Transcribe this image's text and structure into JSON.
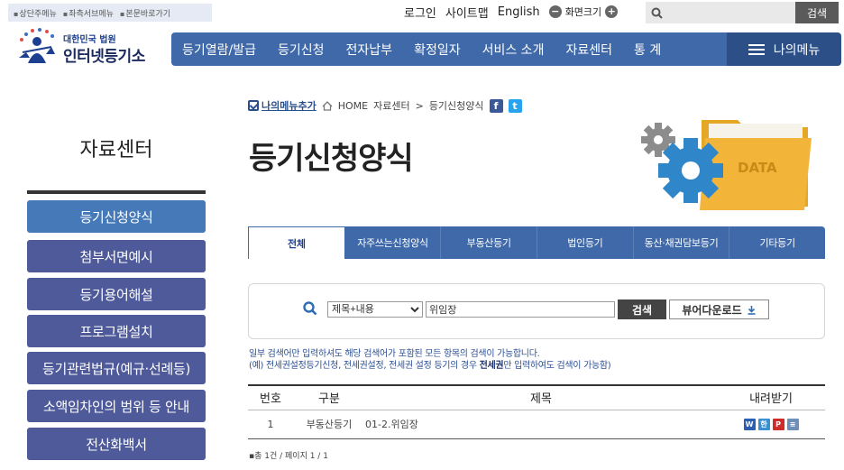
{
  "skip_links": [
    "상단주메뉴",
    "좌측서브메뉴",
    "본문바로가기"
  ],
  "util": {
    "login": "로그인",
    "sitemap": "사이트맵",
    "english": "English",
    "zoom_label": "화면크기",
    "zoom_out": "−",
    "zoom_in": "+"
  },
  "top_search": {
    "placeholder": "",
    "button": "검색"
  },
  "logo": {
    "line1": "대한민국 법원",
    "line2": "인터넷등기소"
  },
  "gnb": {
    "items": [
      "등기열람/발급",
      "등기신청",
      "전자납부",
      "확정일자",
      "서비스 소개",
      "자료센터",
      "통 계"
    ],
    "my_menu": "나의메뉴"
  },
  "sidebar": {
    "title": "자료센터",
    "items": [
      {
        "label": "등기신청양식"
      },
      {
        "label": "첨부서면예시"
      },
      {
        "label": "등기용어해설"
      },
      {
        "label": "프로그램설치"
      },
      {
        "label": "등기관련법규(예규·선례등)"
      },
      {
        "label": "소액임차인의 범위 등 안내"
      },
      {
        "label": "전산화백서"
      }
    ]
  },
  "breadcrumb": {
    "add_menu": "나의메뉴추가",
    "home": "HOME",
    "level1": "자료센터",
    "level2": "등기신청양식",
    "sep": ">"
  },
  "page_title": "등기신청양식",
  "art": {
    "label": "DATA"
  },
  "tabs": [
    "전체",
    "자주쓰는신청양식",
    "부동산등기",
    "법인등기",
    "동산·채권담보등기",
    "기타등기"
  ],
  "search": {
    "select_value": "제목+내용",
    "query": "위임장",
    "button": "검색",
    "viewer_button": "뷰어다운로드"
  },
  "notes": {
    "line1": "일부 검색어만 입력하셔도 해당 검색어가 포함된 모든 항목의 검색이 가능합니다.",
    "line2_pre": "(예) 전세권설정등기신청, 전세권설정, 전세권 설정 등기의 경우 ",
    "line2_bold": "전세권",
    "line2_post": "만 입력하여도 검색이 가능함)"
  },
  "table": {
    "headers": [
      "번호",
      "구분",
      "제목",
      "내려받기"
    ],
    "rows": [
      {
        "no": "1",
        "kind": "부동산등기",
        "title": "01-2.위임장"
      }
    ]
  },
  "count_text": "총 1건 / 페이지 1 / 1"
}
